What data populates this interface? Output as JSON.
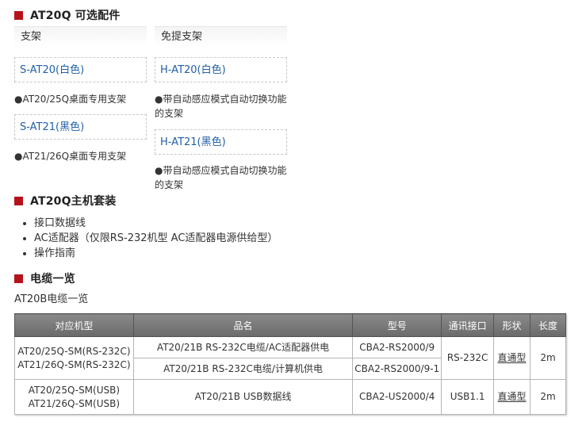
{
  "sections": {
    "accessories": {
      "title": "AT20Q 可选配件"
    },
    "kit": {
      "title": "AT20Q主机套装"
    },
    "cables": {
      "title": "电缆一览"
    }
  },
  "accessories": {
    "col1": {
      "header": "支架",
      "items": [
        {
          "name": "S-AT20(白色)",
          "desc": "●AT20/25Q桌面专用支架"
        },
        {
          "name": "S-AT21(黑色)",
          "desc": "●AT21/26Q桌面专用支架"
        }
      ]
    },
    "col2": {
      "header": "免提支架",
      "items": [
        {
          "name": "H-AT20(白色)",
          "desc_line1": "●带自动感应模式自动切换功能",
          "desc_line2": "的支架"
        },
        {
          "name": "H-AT21(黑色)",
          "desc_line1": "●带自动感应模式自动切换功能",
          "desc_line2": "的支架"
        }
      ]
    }
  },
  "kit_items": [
    "接口数据线",
    "AC适配器（仅限RS-232机型 AC适配器电源供给型）",
    "操作指南"
  ],
  "cable_subtitle": "AT20B电缆一览",
  "table": {
    "headers": [
      "对应机型",
      "品名",
      "型号",
      "通讯接口",
      "形状",
      "长度"
    ],
    "group1": {
      "models_line1": "AT20/25Q-SM(RS-232C)",
      "models_line2": "AT21/26Q-SM(RS-232C)",
      "rows": [
        {
          "name": "AT20/21B RS-232C电缆/AC适配器供电",
          "model": "CBA2-RS2000/9"
        },
        {
          "name": "AT20/21B RS-232C电缆/计算机供电",
          "model": "CBA2-RS2000/9-1"
        }
      ],
      "interface": "RS-232C",
      "shape": "直通型",
      "length": "2m"
    },
    "group2": {
      "models_line1": "AT20/25Q-SM(USB)",
      "models_line2": "AT21/26Q-SM(USB)",
      "name": "AT20/21B USB数据线",
      "model": "CBA2-US2000/4",
      "interface": "USB1.1",
      "shape": "直通型",
      "length": "2m"
    }
  }
}
